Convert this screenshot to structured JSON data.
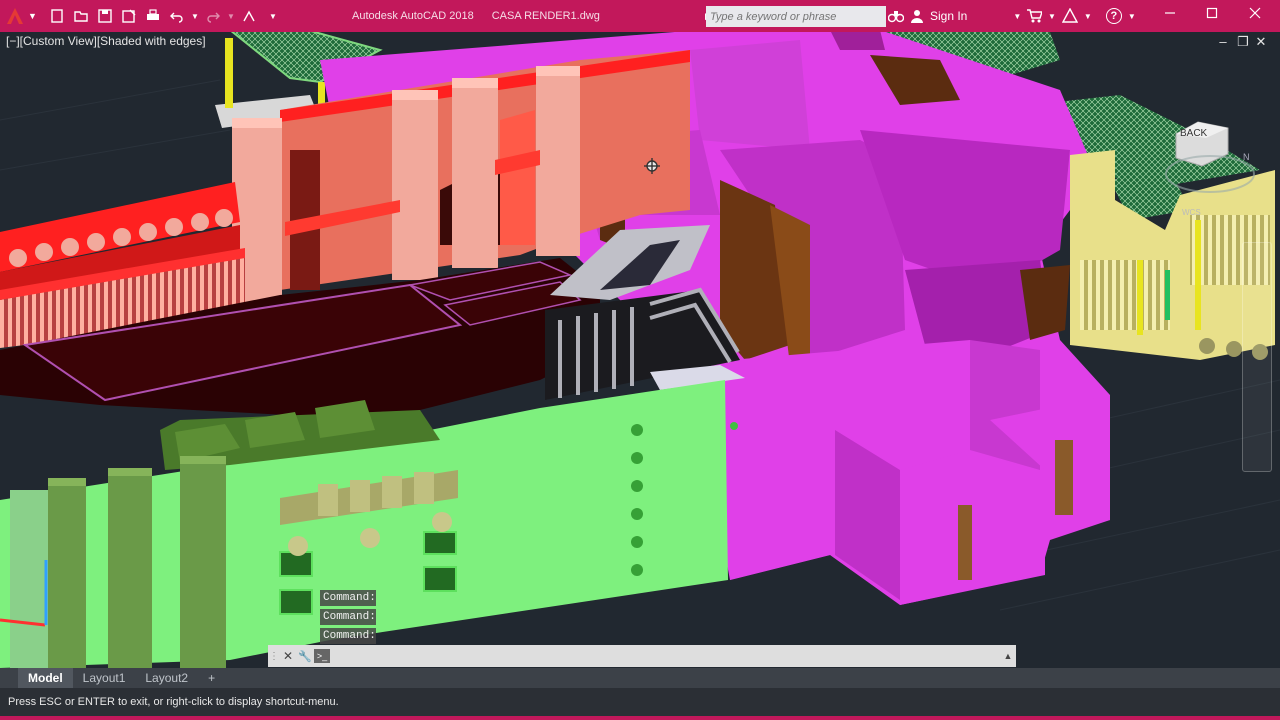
{
  "titlebar": {
    "app_name": "Autodesk AutoCAD 2018",
    "file_name": "CASA RENDER1.dwg",
    "search_placeholder": "Type a keyword or phrase",
    "sign_in": "Sign In",
    "help_label": "?"
  },
  "quick_access": {
    "icons": [
      "new-icon",
      "open-icon",
      "save-icon",
      "save-as-icon",
      "print-icon",
      "undo-icon",
      "redo-icon",
      "share-icon",
      "customize-icon"
    ]
  },
  "viewport": {
    "view_label": "[−][Custom View][Shaded with edges]",
    "viewcube_label": "BACK",
    "compass_label": "WCS"
  },
  "command_window": {
    "history": [
      "Command:",
      "Command:",
      "Command:"
    ],
    "input_placeholder": ""
  },
  "layout_tabs": {
    "tabs": [
      "Model",
      "Layout1",
      "Layout2"
    ],
    "active": "Model",
    "add_label": "+"
  },
  "status": {
    "prompt": "Press ESC or ENTER to exit, or right-click to display shortcut-menu."
  },
  "colors": {
    "titlebar": "#c2185b",
    "viewport_bg": "#212830",
    "magenta": "#e040e8",
    "green": "#7ef07e",
    "salmon": "#e8705e",
    "yellow": "#e8e08a"
  }
}
